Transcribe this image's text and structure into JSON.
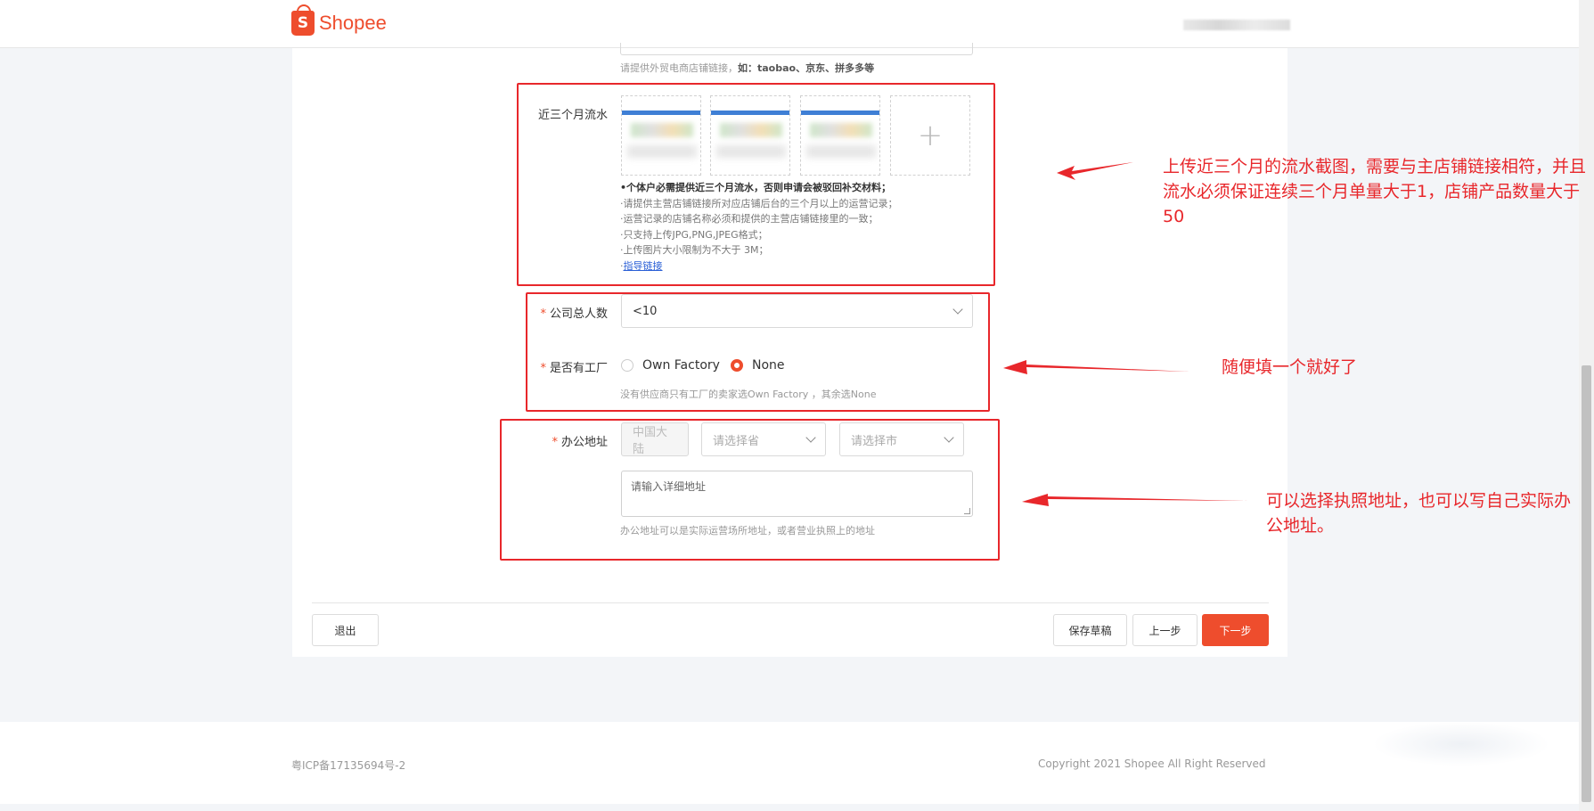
{
  "header": {
    "logo_letter": "S",
    "logo_text": "Shopee"
  },
  "store_link": {
    "hint_prefix": "请提供外贸电商店铺链接，",
    "hint_bold": "如：taobao、京东、拼多多等"
  },
  "turnover": {
    "label": "近三个月流水",
    "add_symbol": "+",
    "notes": {
      "strong": "•个体户必需提供近三个月流水，否则申请会被驳回补交材料；",
      "n1": "·请提供主营店铺链接所对应店铺后台的三个月以上的运营记录；",
      "n2": "·运营记录的店铺名称必须和提供的主营店铺链接里的一致；",
      "n3": "·只支持上传JPG,PNG,JPEG格式；",
      "n4": "·上传图片大小限制为不大于 3M；",
      "link_prefix": "·",
      "link": "指导链接"
    }
  },
  "staff": {
    "required": "*",
    "label": "公司总人数",
    "value": "<10"
  },
  "factory": {
    "required": "*",
    "label": "是否有工厂",
    "options": [
      {
        "label": "Own Factory",
        "selected": false
      },
      {
        "label": "None",
        "selected": true
      }
    ],
    "hint": "没有供应商只有工厂的卖家选Own Factory ，其余选None"
  },
  "address": {
    "required": "*",
    "label": "办公地址",
    "country": "中国大陆",
    "province_placeholder": "请选择省",
    "city_placeholder": "请选择市",
    "detail_placeholder": "请输入详细地址",
    "hint": "办公地址可以是实际运营场所地址，或者营业执照上的地址"
  },
  "actions": {
    "exit": "退出",
    "save_draft": "保存草稿",
    "prev": "上一步",
    "next": "下一步"
  },
  "annotations": {
    "a1": "上传近三个月的流水截图，需要与主店铺链接相符，并且流水必须保证连续三个月单量大于1，店铺产品数量大于50",
    "a2": "随便填一个就好了",
    "a3": "可以选择执照地址，也可以写自己实际办公地址。"
  },
  "footer": {
    "icp": "粤ICP备17135694号-2",
    "copyright": "Copyright 2021 Shopee All Right Reserved"
  },
  "colors": {
    "brand": "#ee4d2d",
    "annotation": "#e8272b"
  }
}
